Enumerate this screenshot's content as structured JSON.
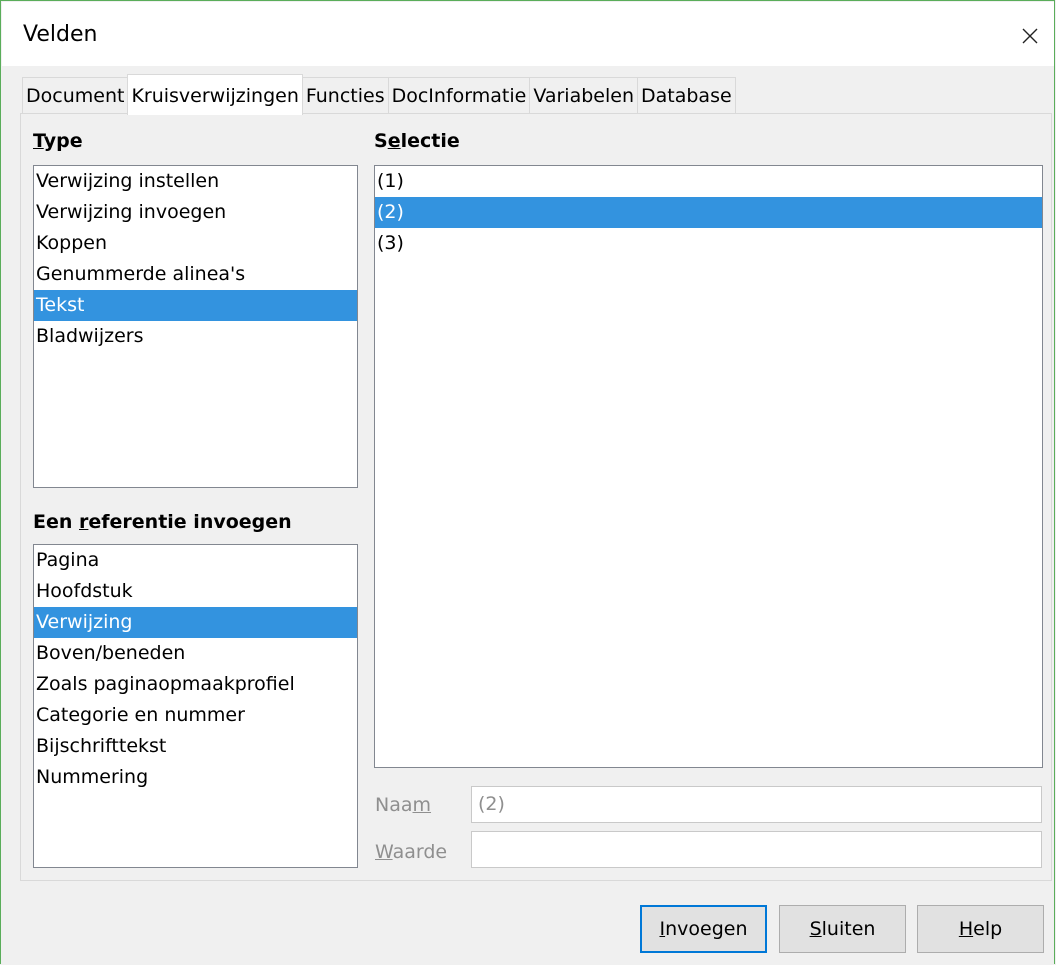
{
  "window": {
    "title": "Velden"
  },
  "tabs": [
    {
      "label": "Document"
    },
    {
      "label": "Kruisverwijzingen"
    },
    {
      "label": "Functies"
    },
    {
      "label": "DocInformatie"
    },
    {
      "label": "Variabelen"
    },
    {
      "label": "Database"
    }
  ],
  "active_tab": "Kruisverwijzingen",
  "type": {
    "header": {
      "pre": "",
      "mn": "T",
      "post": "ype"
    },
    "items": [
      {
        "label": "Verwijzing instellen"
      },
      {
        "label": "Verwijzing invoegen"
      },
      {
        "label": "Koppen"
      },
      {
        "label": "Genummerde alinea's"
      },
      {
        "label": "Tekst"
      },
      {
        "label": "Bladwijzers"
      }
    ],
    "selected": "Tekst"
  },
  "reference": {
    "header": {
      "pre": "Een ",
      "mn": "r",
      "post": "eferentie invoegen"
    },
    "items": [
      {
        "label": "Pagina"
      },
      {
        "label": "Hoofdstuk"
      },
      {
        "label": "Verwijzing"
      },
      {
        "label": "Boven/beneden"
      },
      {
        "label": "Zoals paginaopmaakprofiel"
      },
      {
        "label": "Categorie en nummer"
      },
      {
        "label": "Bijschrifttekst"
      },
      {
        "label": "Nummering"
      }
    ],
    "selected": "Verwijzing"
  },
  "selection": {
    "header": {
      "pre": "S",
      "mn": "e",
      "post": "lectie"
    },
    "items": [
      {
        "label": "(1)"
      },
      {
        "label": "(2)"
      },
      {
        "label": "(3)"
      }
    ],
    "selected": "(2)"
  },
  "name_field": {
    "label": {
      "pre": "Naa",
      "mn": "m",
      "post": ""
    },
    "value": "(2)"
  },
  "value_field": {
    "label": {
      "pre": "",
      "mn": "W",
      "post": "aarde"
    },
    "value": ""
  },
  "buttons": {
    "insert": {
      "pre": "",
      "mn": "I",
      "post": "nvoegen"
    },
    "close": {
      "pre": "",
      "mn": "S",
      "post": "luiten"
    },
    "help": {
      "pre": "",
      "mn": "H",
      "post": "elp"
    }
  },
  "colors": {
    "selection": "#3393df",
    "focus_border": "#0078d7",
    "window_border": "#5aad5a"
  }
}
